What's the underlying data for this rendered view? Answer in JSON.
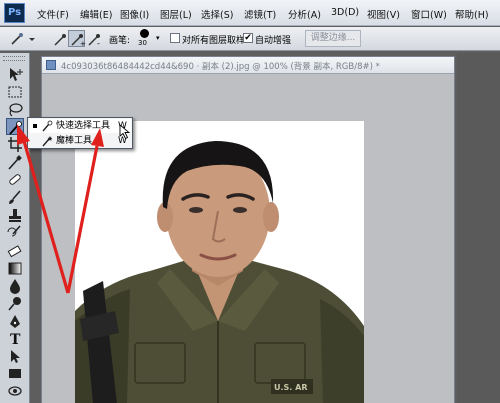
{
  "app": {
    "logo": "Ps",
    "menu": [
      "文件(F)",
      "编辑(E)",
      "图像(I)",
      "图层(L)",
      "选择(S)",
      "滤镜(T)",
      "分析(A)",
      "3D(D)",
      "视图(V)",
      "窗口(W)",
      "帮助(H)"
    ]
  },
  "options_bar": {
    "brush_label": "画笔:",
    "brush_size": "30",
    "sample_all_layers": {
      "label": "对所有图层取样",
      "checked": false
    },
    "auto_enhance": {
      "label": "自动增强",
      "checked": true,
      "mark": "✔"
    },
    "refine_edge": "调整边缘..."
  },
  "document": {
    "title": "4c093036t86484442cd44&690 · 副本 (2).jpg @ 100% (背景 副本, RGB/8#) *"
  },
  "flyout": {
    "items": [
      {
        "label": "快速选择工具",
        "shortcut": "W",
        "active": true
      },
      {
        "label": "魔棒工具",
        "shortcut": "W",
        "active": false
      }
    ]
  },
  "photo": {
    "badge_text": "U.S. AR"
  },
  "colors": {
    "arrow": "#e0201c",
    "selected_tool": "#7d95bd",
    "canvas_bg": "#bdbfc3"
  }
}
